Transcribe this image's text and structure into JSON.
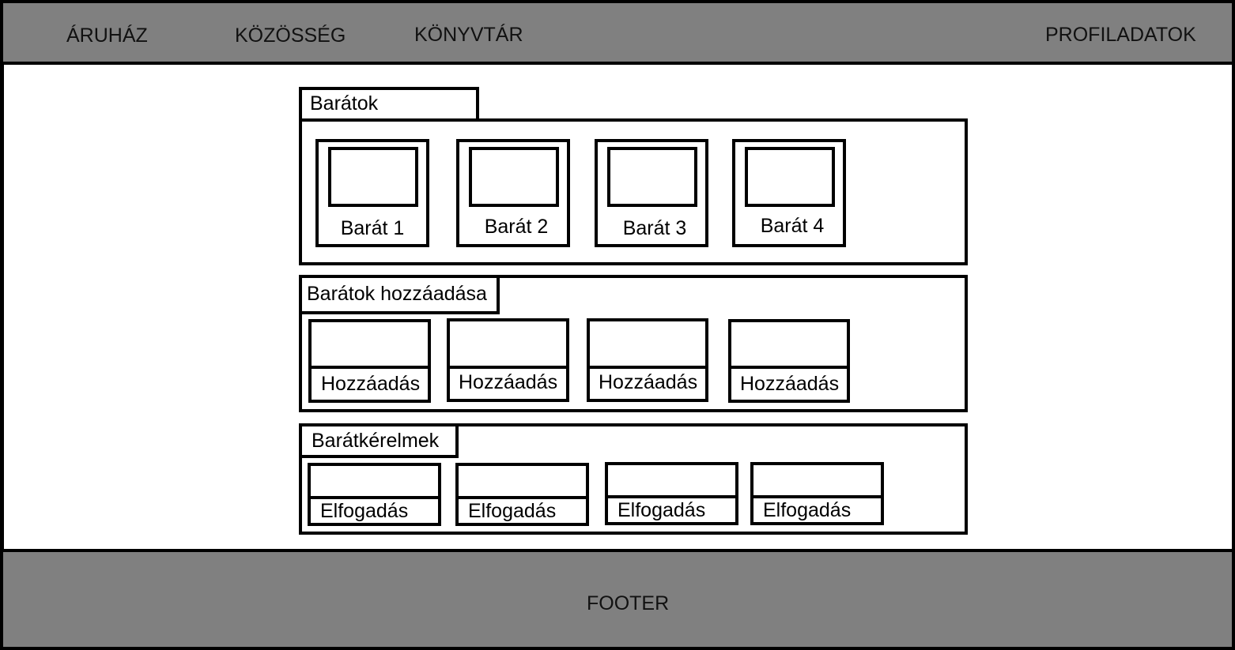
{
  "nav": {
    "store": "ÁRUHÁZ",
    "community": "KÖZÖSSÉG",
    "library": "KÖNYVTÁR",
    "profile": "PROFILADATOK"
  },
  "friends": {
    "title": "Barátok",
    "items": [
      "Barát 1",
      "Barát 2",
      "Barát 3",
      "Barát 4"
    ]
  },
  "add_friends": {
    "title": "Barátok hozzáadása",
    "button_labels": [
      "Hozzáadás",
      "Hozzáadás",
      "Hozzáadás",
      "Hozzáadás"
    ]
  },
  "requests": {
    "title": "Barátkérelmek",
    "button_labels": [
      "Elfogadás",
      "Elfogadás",
      "Elfogadás",
      "Elfogadás"
    ]
  },
  "footer": {
    "text": "FOOTER"
  }
}
